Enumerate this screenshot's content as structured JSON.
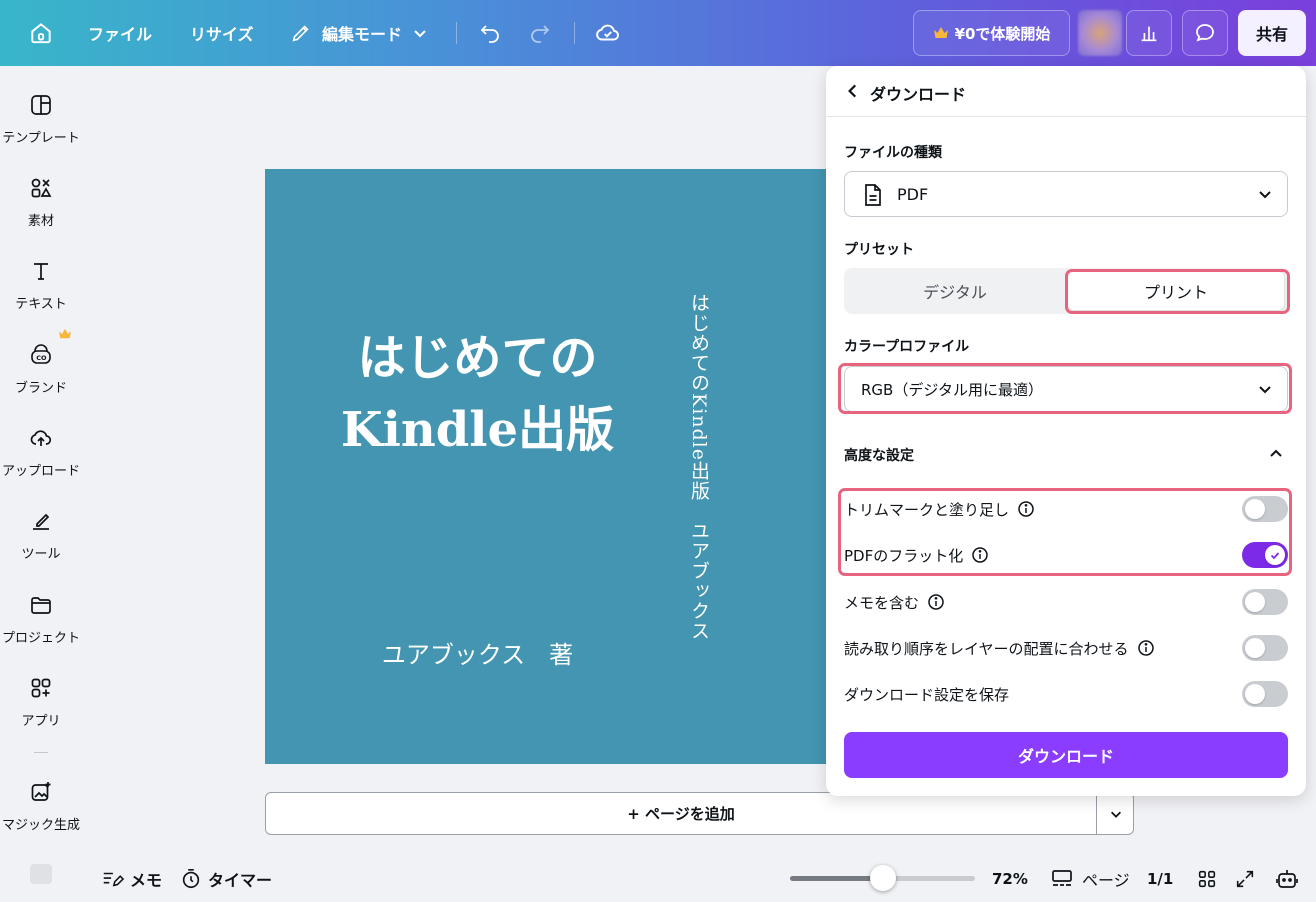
{
  "topbar": {
    "file": "ファイル",
    "resize": "リサイズ",
    "edit_mode": "編集モード",
    "trial": "¥0で体験開始",
    "share": "共有"
  },
  "sidebar": {
    "items": [
      {
        "label": "テンプレート",
        "icon": "template-icon"
      },
      {
        "label": "素材",
        "icon": "elements-icon"
      },
      {
        "label": "テキスト",
        "icon": "text-icon"
      },
      {
        "label": "ブランド",
        "icon": "brand-icon"
      },
      {
        "label": "アップロード",
        "icon": "upload-icon"
      },
      {
        "label": "ツール",
        "icon": "tools-icon"
      },
      {
        "label": "プロジェクト",
        "icon": "folder-icon"
      },
      {
        "label": "アプリ",
        "icon": "apps-icon"
      },
      {
        "label": "マジック生成",
        "icon": "magic-media-icon"
      }
    ]
  },
  "canvas": {
    "title_line1": "はじめての",
    "title_line2": "Kindle出版",
    "author": "ユアブックス　著",
    "vertical": "はじめてのKindle出版　ユアブックス"
  },
  "add_page": "+ ページを追加",
  "bottombar": {
    "memo": "メモ",
    "timer": "タイマー",
    "zoom": "72%",
    "zoom_value": 0.5,
    "pages": "ページ",
    "page_count": "1/1"
  },
  "panel": {
    "title": "ダウンロード",
    "file_type_label": "ファイルの種類",
    "file_type_value": "PDF",
    "preset_label": "プリセット",
    "preset_options": [
      "デジタル",
      "プリント"
    ],
    "preset_selected": "プリント",
    "color_profile_label": "カラープロファイル",
    "color_profile_value": "RGB（デジタル用に最適）",
    "advanced_label": "高度な設定",
    "toggles": [
      {
        "label": "トリムマークと塗り足し",
        "on": false,
        "info": true
      },
      {
        "label": "PDFのフラット化",
        "on": true,
        "info": true
      },
      {
        "label": "メモを含む",
        "on": false,
        "info": true
      },
      {
        "label": "読み取り順序をレイヤーの配置に合わせる",
        "on": false,
        "info": true
      },
      {
        "label": "ダウンロード設定を保存",
        "on": false,
        "info": false
      }
    ],
    "download_button": "ダウンロード"
  },
  "colors": {
    "accent": "#8b3dff",
    "toggle_on": "#7d2ae8",
    "highlight": "#e8637d",
    "canvas_bg": "#4395b1"
  }
}
